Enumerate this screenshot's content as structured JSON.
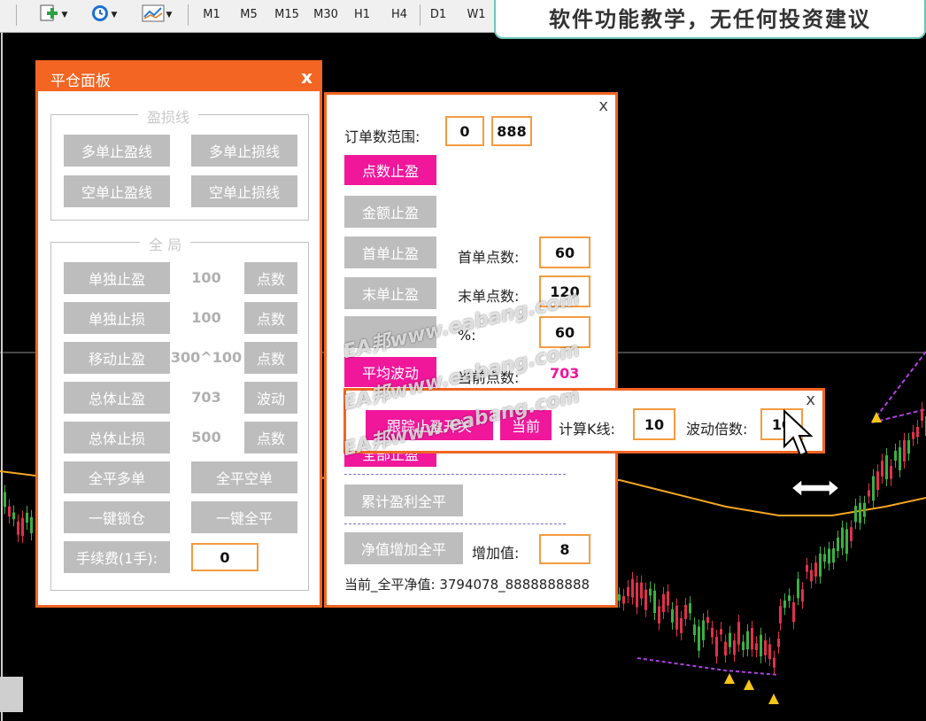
{
  "toolbar": {
    "timeframes": [
      "M1",
      "M5",
      "M15",
      "M30",
      "H1",
      "H4",
      "D1",
      "W1"
    ]
  },
  "notice": "软件功能教学，无任何投资建议",
  "panel_close": {
    "title": "平仓面板",
    "close": "x",
    "group1": {
      "label": "盈损线",
      "buttons": [
        "多单止盈线",
        "多单止损线",
        "空单止盈线",
        "空单止损线"
      ]
    },
    "group2": {
      "label": "全 局",
      "rows": [
        {
          "button": "单独止盈",
          "value": "100",
          "unit": "点数"
        },
        {
          "button": "单独止损",
          "value": "100",
          "unit": "点数"
        },
        {
          "button": "移动止盈",
          "value": "300^100",
          "unit": "点数"
        },
        {
          "button": "总体止盈",
          "value": "703",
          "unit": "波动"
        },
        {
          "button": "总体止损",
          "value": "500",
          "unit": "点数"
        }
      ],
      "close_long": "全平多单",
      "close_short": "全平空单",
      "lock": "一键锁仓",
      "close_all": "一键全平",
      "fee_label": "手续费(1手):",
      "fee_value": "0"
    }
  },
  "panel_tp": {
    "close": "x",
    "range_label": "订单数范围:",
    "range_from": "0",
    "range_to": "888",
    "points_tp": "点数止盈",
    "amount_tp": "金额止盈",
    "first_tp": "首单止盈",
    "first_points_label": "首单点数:",
    "first_points": "60",
    "last_tp": "末单止盈",
    "last_points_label": "末单点数:",
    "last_points": "120",
    "pct_label": "%:",
    "pct_value": "60",
    "avg_wave": "平均波动",
    "current_points_label": "当前点数:",
    "current_points": "703",
    "hidden_pink": "全部止盈",
    "cum_profit": "累计盈利全平",
    "equity_btn": "净值增加全平",
    "add_label": "增加值:",
    "add_value": "8",
    "equity_line": "当前_全平净值: 3794078_8888888888"
  },
  "panel_trail": {
    "close": "x",
    "switch": "跟踪止盈开关",
    "current": "当前",
    "k_label": "计算K线:",
    "k_value": "10",
    "mult_label": "波动倍数:",
    "mult_value": "10"
  },
  "watermark": "EA邦www.eabang.com",
  "colors": {
    "accent": "#f26522",
    "pink": "#f0179b",
    "gray_button": "#bdbdbd",
    "input_border": "#f39c41"
  }
}
